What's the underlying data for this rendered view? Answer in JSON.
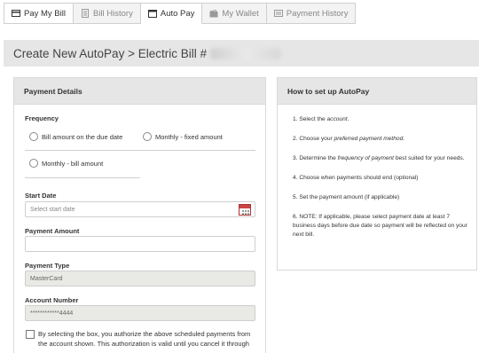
{
  "tabs": [
    {
      "label": "Pay My Bill",
      "icon": "credit-card-icon"
    },
    {
      "label": "Bill History",
      "icon": "document-icon"
    },
    {
      "label": "Auto Pay",
      "icon": "calendar-icon"
    },
    {
      "label": "My Wallet",
      "icon": "wallet-icon"
    },
    {
      "label": "Payment History",
      "icon": "receipt-icon"
    }
  ],
  "header": {
    "title": "Create New AutoPay > Electric Bill #"
  },
  "payment_details": {
    "title": "Payment Details",
    "frequency_label": "Frequency",
    "freq_options": [
      "Bill amount on the due date",
      "Monthly - fixed amount",
      "Monthly - bill amount"
    ],
    "start_date_label": "Start Date",
    "start_date_placeholder": "Select start date",
    "payment_amount_label": "Payment Amount",
    "payment_amount_value": "",
    "payment_type_label": "Payment Type",
    "payment_type_value": "MasterCard",
    "account_number_label": "Account Number",
    "account_number_value": "************4444",
    "authorization_text_1": "By selecting the box, you authorize the above scheduled payments from",
    "authorization_text_2": "the account shown. This authorization is valid until you cancel it through"
  },
  "howto": {
    "title": "How to set up AutoPay",
    "step1_a": "1. Select the ",
    "step1_em": "account",
    "step1_b": ".",
    "step2_a": "2. Choose your ",
    "step2_em": "preferred payment method",
    "step2_b": ".",
    "step3_a": "3. Determine the ",
    "step3_em": "frequency of payment",
    "step3_b": " best suited for your needs.",
    "step4": "4. Choose when payments should end (optional)",
    "step5": "5. Set the payment amount (if applicable)",
    "step6": "6. NOTE: If applicable, please select payment date at least 7 business days before due date so payment will be reflected on your next bill."
  }
}
